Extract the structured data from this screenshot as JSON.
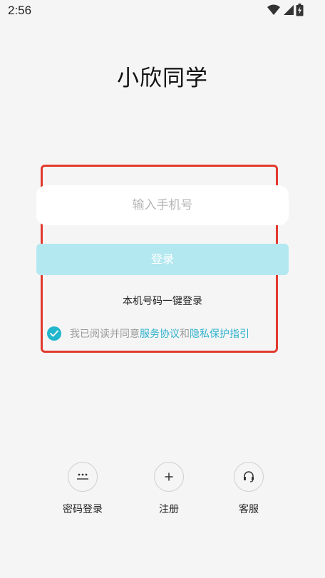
{
  "status_bar": {
    "time": "2:56",
    "icons": [
      "wifi-icon",
      "signal-icon",
      "battery-icon"
    ]
  },
  "app": {
    "title": "小欣同学"
  },
  "login_form": {
    "phone_placeholder": "输入手机号",
    "phone_value": "",
    "login_button": "登录",
    "one_click_login": "本机号码一键登录",
    "agreement": {
      "checked": true,
      "prefix": "我已阅读并同意",
      "service_link": "服务协议",
      "and": "和",
      "privacy_link": "隐私保护指引"
    }
  },
  "bottom_actions": [
    {
      "label": "密码登录",
      "icon": "password-dots-icon"
    },
    {
      "label": "注册",
      "icon": "plus-icon"
    },
    {
      "label": "客服",
      "icon": "headset-icon"
    }
  ],
  "colors": {
    "accent": "#21b6cc",
    "button_disabled_bg": "#b3e8f0",
    "highlight_border": "#e23a2e",
    "background": "#f5f5f5"
  }
}
